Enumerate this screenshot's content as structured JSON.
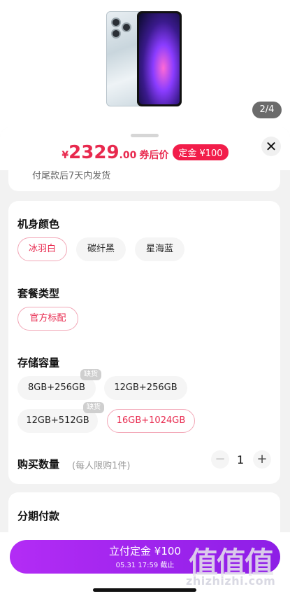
{
  "gallery": {
    "page_indicator": "2/4"
  },
  "price": {
    "currency": "¥",
    "integer": "2329",
    "decimal": ".00",
    "suffix": "券后价",
    "deposit_badge": "定金 ¥100"
  },
  "shipping": {
    "text": "付尾款后7天内发货"
  },
  "spec": {
    "color": {
      "title": "机身颜色",
      "options": [
        "冰羽白",
        "碳纤黑",
        "星海蓝"
      ],
      "selected": "冰羽白"
    },
    "package": {
      "title": "套餐类型",
      "options": [
        "官方标配"
      ],
      "selected": "官方标配"
    },
    "storage": {
      "title": "存储容量",
      "options": [
        "8GB+256GB",
        "12GB+256GB",
        "12GB+512GB",
        "16GB+1024GB"
      ],
      "selected": "16GB+1024GB",
      "out_of_stock_tag": "缺货"
    },
    "quantity": {
      "label": "购买数量",
      "note": "(每人限购1件)",
      "value": "1",
      "minus": "−",
      "plus": "+"
    }
  },
  "installment": {
    "title": "分期付款"
  },
  "pay_button": {
    "label": "立付定金 ¥100",
    "deadline": "05.31 17:59 截止"
  },
  "close_symbol": "✕",
  "watermark": {
    "logo": "值值值",
    "url": "zhizhizhi.com"
  },
  "colors": {
    "accent": "#e8294e",
    "pay_gradient_start": "#b32cf5",
    "pay_gradient_end": "#8d1ee6"
  }
}
